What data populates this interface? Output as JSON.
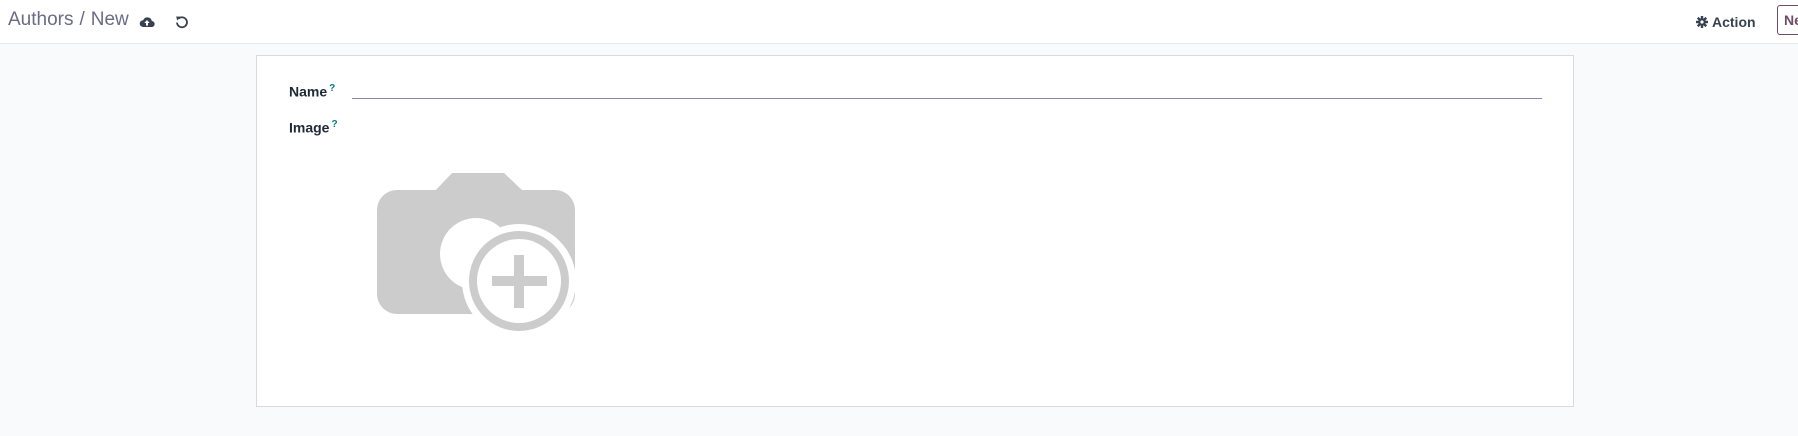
{
  "breadcrumb": {
    "parent": "Authors",
    "separator": "/",
    "current": "New"
  },
  "toolbar": {
    "save_icon": "cloud-upload-icon",
    "discard_icon": "undo-icon",
    "action_icon": "gear-icon",
    "action_label": "Action",
    "new_label": "New"
  },
  "form": {
    "name_label": "Name",
    "name_help": "?",
    "name_value": "",
    "image_label": "Image",
    "image_help": "?",
    "image_icon": "camera-add-placeholder-icon"
  },
  "colors": {
    "brand": "#714b67",
    "breadcrumb": "#6b6b88",
    "help": "#017e84",
    "placeholder": "#cccccc"
  }
}
